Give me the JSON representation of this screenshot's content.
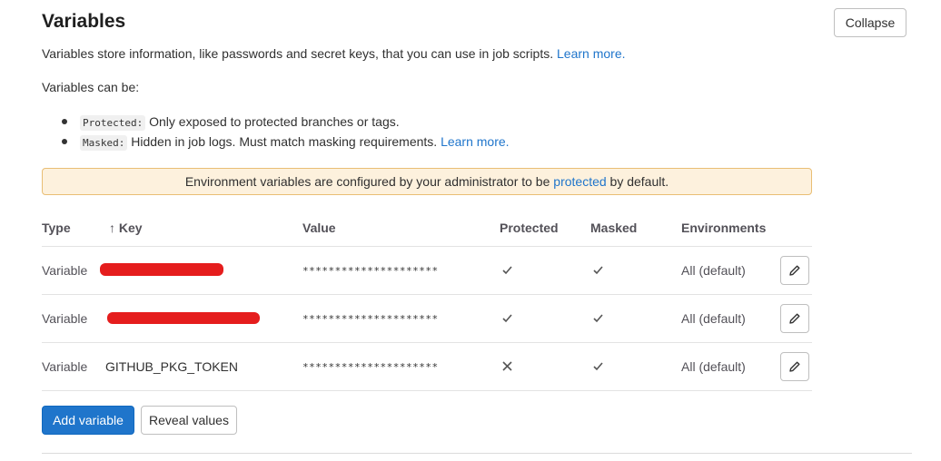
{
  "header": {
    "title": "Variables",
    "collapse_label": "Collapse"
  },
  "intro": {
    "text": "Variables store information, like passwords and secret keys, that you can use in job scripts.",
    "learn_more": "Learn more."
  },
  "can_be": "Variables can be:",
  "bullets": [
    {
      "code": "Protected:",
      "text": "Only exposed to protected branches or tags.",
      "link": ""
    },
    {
      "code": "Masked:",
      "text": "Hidden in job logs. Must match masking requirements.",
      "link": "Learn more."
    }
  ],
  "alert": {
    "before": "Environment variables are configured by your administrator to be",
    "link": "protected",
    "after": "by default."
  },
  "table": {
    "headers": {
      "type": "Type",
      "sort_arrow": "↑",
      "key": "Key",
      "value": "Value",
      "protected": "Protected",
      "masked": "Masked",
      "environments": "Environments"
    },
    "rows": [
      {
        "type": "Variable",
        "key": "",
        "key_redacted": true,
        "value": "*********************",
        "protected": "check",
        "masked": "check",
        "environment": "All (default)"
      },
      {
        "type": "Variable",
        "key": "",
        "key_redacted": true,
        "value": "*********************",
        "protected": "check",
        "masked": "check",
        "environment": "All (default)"
      },
      {
        "type": "Variable",
        "key": "GITHUB_PKG_TOKEN",
        "key_redacted": false,
        "value": "*********************",
        "protected": "cross",
        "masked": "check",
        "environment": "All (default)"
      }
    ]
  },
  "actions": {
    "add_variable": "Add variable",
    "reveal_values": "Reveal values"
  },
  "colors": {
    "primary": "#1f75cb",
    "alert_bg": "#fdf1dd",
    "alert_border": "#e9be74",
    "redaction": "#e51d1d"
  },
  "icons": {
    "check": "check-icon",
    "cross": "close-icon",
    "edit": "pencil-icon",
    "sort": "sort-ascending-icon",
    "bullet": "bullet-dot-icon"
  }
}
